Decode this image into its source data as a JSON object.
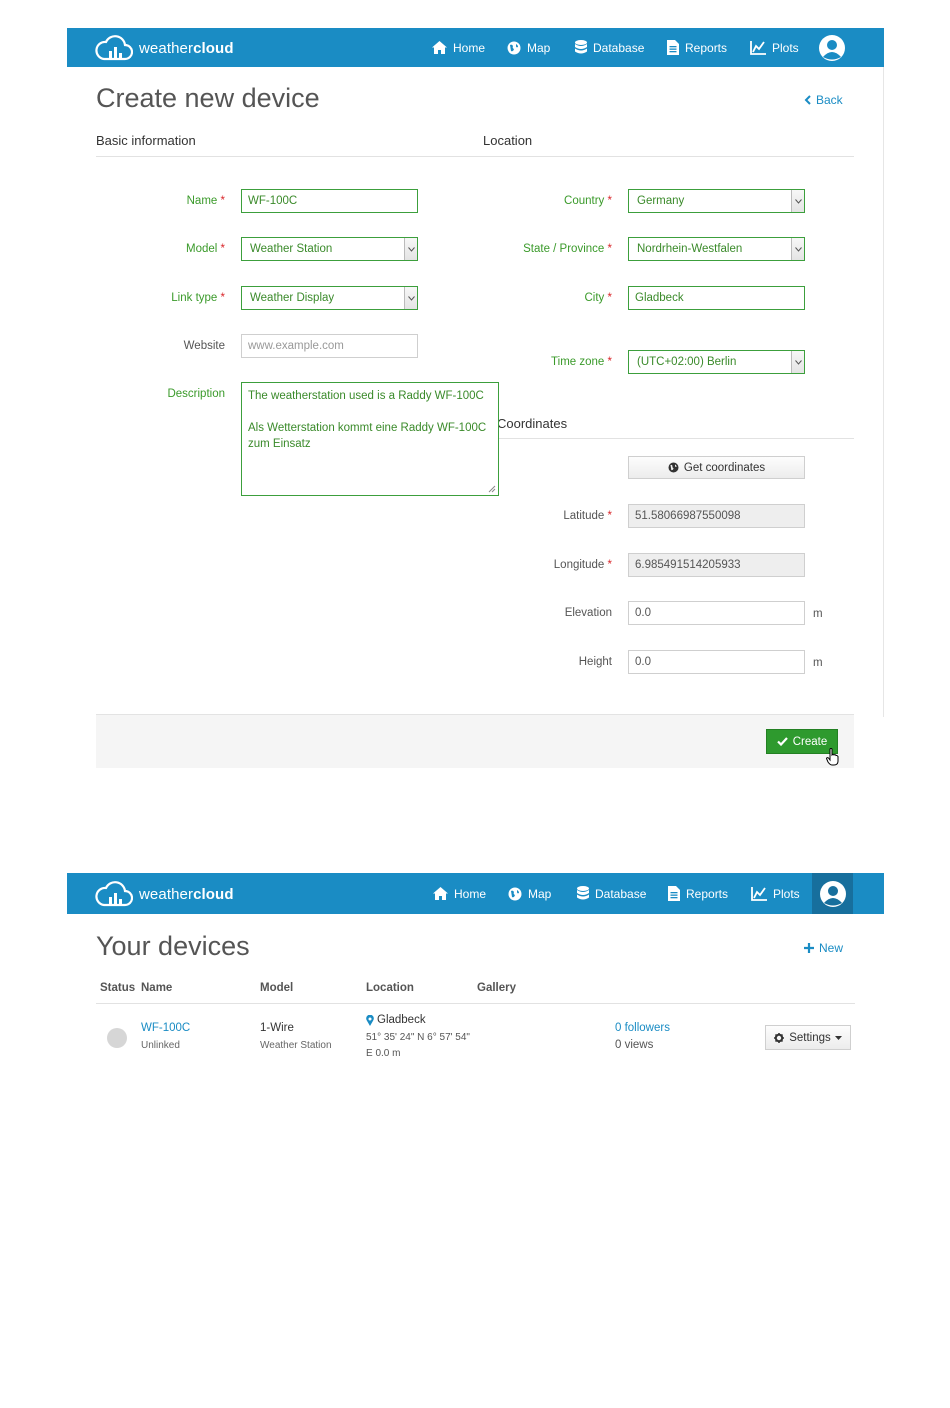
{
  "brand": {
    "light": "weather",
    "bold": "cloud"
  },
  "nav": {
    "home": "Home",
    "map": "Map",
    "database": "Database",
    "reports": "Reports",
    "plots": "Plots"
  },
  "colors": {
    "navbar": "#1a8cc4",
    "valid_green": "#3a9a2a",
    "create_button": "#2e9a2e",
    "required": "#d9262a",
    "link": "#1a8cc4"
  },
  "create_form": {
    "title": "Create new device",
    "back": "Back",
    "basic_section": "Basic information",
    "location_section": "Location",
    "coordinates_section": "Coordinates",
    "name": {
      "label": "Name",
      "value": "WF-100C"
    },
    "model": {
      "label": "Model",
      "value": "Weather Station"
    },
    "link_type": {
      "label": "Link type",
      "value": "Weather Display"
    },
    "website": {
      "label": "Website",
      "placeholder": "www.example.com"
    },
    "description": {
      "label": "Description",
      "line1": "The weatherstation used is a Raddy WF-100C",
      "line2": "Als Wetterstation kommt eine Raddy WF-100C",
      "line3": "zum Einsatz"
    },
    "country": {
      "label": "Country",
      "value": "Germany"
    },
    "state": {
      "label": "State / Province",
      "value": "Nordrhein-Westfalen"
    },
    "city": {
      "label": "City",
      "value": "Gladbeck"
    },
    "timezone": {
      "label": "Time zone",
      "value": "(UTC+02:00) Berlin"
    },
    "get_coordinates": "Get coordinates",
    "latitude": {
      "label": "Latitude",
      "value": "51.58066987550098"
    },
    "longitude": {
      "label": "Longitude",
      "value": "6.985491514205933"
    },
    "elevation": {
      "label": "Elevation",
      "value": "0.0",
      "unit": "m"
    },
    "height": {
      "label": "Height",
      "value": "0.0",
      "unit": "m"
    },
    "required_mark": "*",
    "create": "Create"
  },
  "devices": {
    "title": "Your devices",
    "new": "New",
    "columns": {
      "status": "Status",
      "name": "Name",
      "model": "Model",
      "location": "Location",
      "gallery": "Gallery"
    },
    "row": {
      "name": "WF-100C",
      "link_status": "Unlinked",
      "model": "1-Wire",
      "model_type": "Weather Station",
      "city": "Gladbeck",
      "coords": "51° 35' 24\" N  6° 57' 54\"",
      "elev": "E  0.0 m",
      "followers": "0 followers",
      "views": "0 views",
      "settings": "Settings"
    }
  }
}
